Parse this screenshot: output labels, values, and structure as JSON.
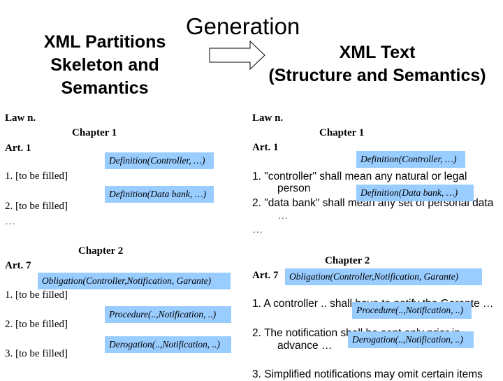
{
  "header": {
    "left_title": [
      "XML Partitions",
      "Skeleton and",
      "Semantics"
    ],
    "center_title": "Generation",
    "right_title": [
      "XML Text",
      "(Structure and Semantics)"
    ],
    "arrow_icon": "right-arrow-icon"
  },
  "left_panel": {
    "law": "Law n.",
    "chapter1": "Chapter 1",
    "art1": "Art. 1",
    "art1_items": [
      "1. [to be filled]",
      "2. [to be filled]"
    ],
    "ellipsis": "…",
    "chapter2": "Chapter 2",
    "art7": "Art. 7",
    "art7_items": [
      "1. [to be filled]",
      "2. [to be filled]",
      "3. [to be filled]"
    ],
    "tags": {
      "def_controller": "Definition(Controller, …)",
      "def_databank": "Definition(Data bank, …)",
      "obligation": "Obligation(Controller,Notification, Garante)",
      "procedure": "Procedure(..,Notification, ..)",
      "derogation": "Derogation(..,Notification, ..)"
    }
  },
  "right_panel": {
    "law": "Law n.",
    "chapter1": "Chapter 1",
    "art1": "Art. 1",
    "art1_items": [
      "1. \"controller\" shall mean any natural or legal",
      "person",
      "2. \"data bank\" shall mean any set of personal data",
      "…"
    ],
    "ellipsis": "…",
    "chapter2": "Chapter 2",
    "art7": "Art. 7",
    "art7_items": [
      "1. A controller .. shall have to notify the Garante …",
      "2. The notification shall be sent only prior in",
      "advance …",
      "3. Simplified notifications may omit certain items"
    ],
    "tags": {
      "def_controller": "Definition(Controller, …)",
      "def_databank": "Definition(Data bank, …)",
      "obligation": "Obligation(Controller,Notification, Garante)",
      "procedure": "Procedure(..,Notification, ..)",
      "derogation": "Derogation(..,Notification, ..)"
    }
  },
  "colors": {
    "tag_background": "#99ccff"
  }
}
